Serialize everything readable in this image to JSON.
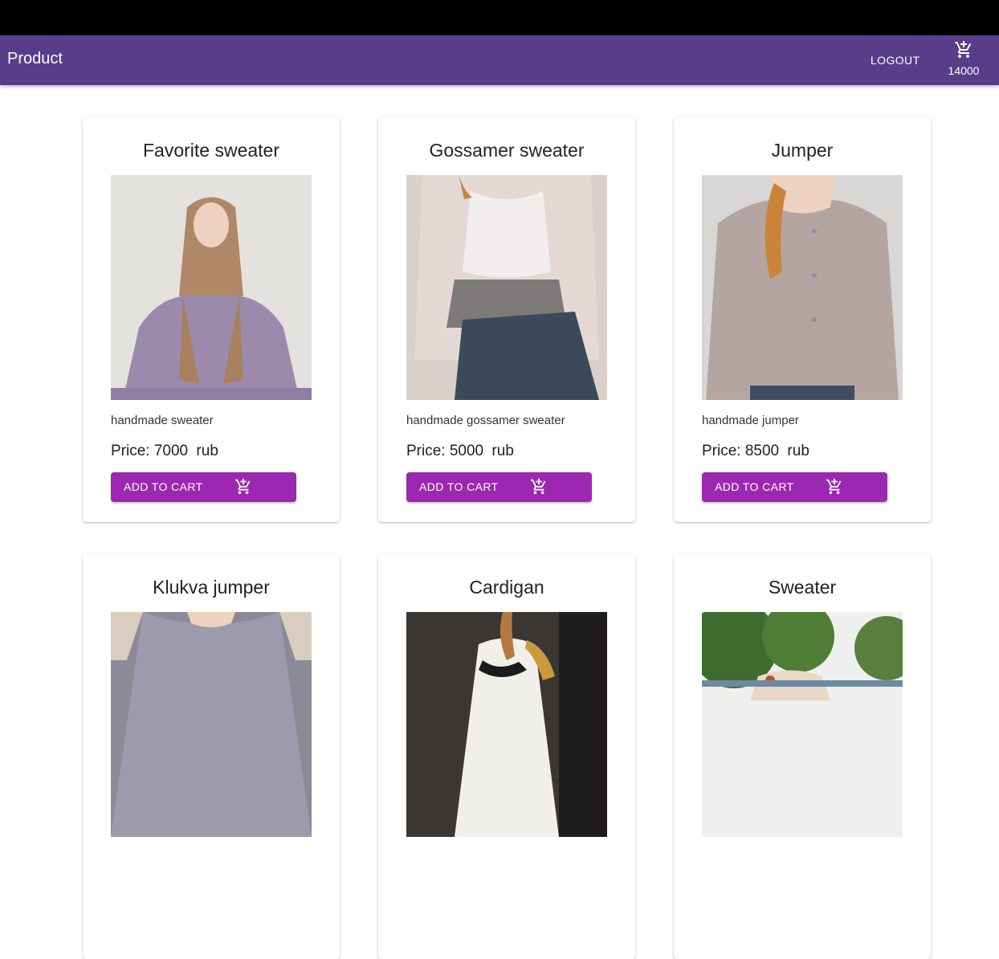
{
  "appbar": {
    "title": "Product",
    "logout_label": "LOGOUT",
    "cart_total": "14000",
    "cart_icon": "add-shopping-cart-icon",
    "background": "#583d8a"
  },
  "products": [
    {
      "name": "Favorite sweater",
      "description": "handmade sweater",
      "price_label": "Price:",
      "price": "7000",
      "currency": "rub",
      "button_label": "ADD TO CART"
    },
    {
      "name": "Gossamer sweater",
      "description": "handmade gossamer sweater",
      "price_label": "Price:",
      "price": "5000",
      "currency": "rub",
      "button_label": "ADD TO CART"
    },
    {
      "name": "Jumper",
      "description": "handmade jumper",
      "price_label": "Price:",
      "price": "8500",
      "currency": "rub",
      "button_label": "ADD TO CART"
    },
    {
      "name": "Klukva jumper"
    },
    {
      "name": "Cardigan"
    },
    {
      "name": "Sweater"
    }
  ],
  "colors": {
    "button": "#9c27b0",
    "topband": "#000000"
  }
}
